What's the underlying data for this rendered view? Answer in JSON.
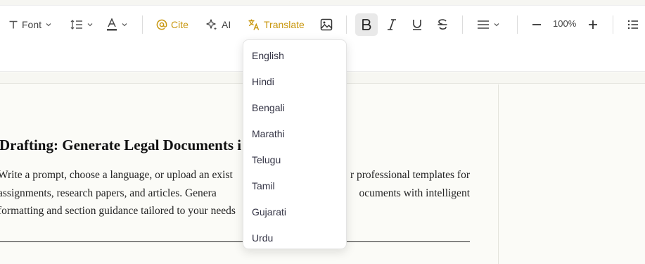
{
  "toolbar": {
    "font_label": "Font",
    "cite_label": "Cite",
    "ai_label": "AI",
    "translate_label": "Translate",
    "zoom_value": "100%",
    "accent_color": "#c8960c",
    "icons": [
      "text-icon",
      "line-spacing-icon",
      "text-color-icon",
      "at-icon",
      "sparkle-icon",
      "translate-icon",
      "image-icon",
      "bold-icon",
      "italic-icon",
      "underline-icon",
      "strikethrough-icon",
      "align-icon",
      "zoom-out-icon",
      "zoom-in-icon",
      "list-icon"
    ]
  },
  "translate_menu": {
    "options": [
      "English",
      "Hindi",
      "Bengali",
      "Marathi",
      "Telugu",
      "Tamil",
      "Gujarati",
      "Urdu"
    ]
  },
  "document": {
    "title": "Drafting: Generate Legal Documents i",
    "line1_a": "Write a prompt, choose a language, or upload an exist",
    "line1_b": "r professional templates for",
    "line2_a": "assignments, research papers, and articles. Genera",
    "line2_b": "ocuments with intelligent",
    "line3": "formatting and section guidance tailored to your needs"
  }
}
